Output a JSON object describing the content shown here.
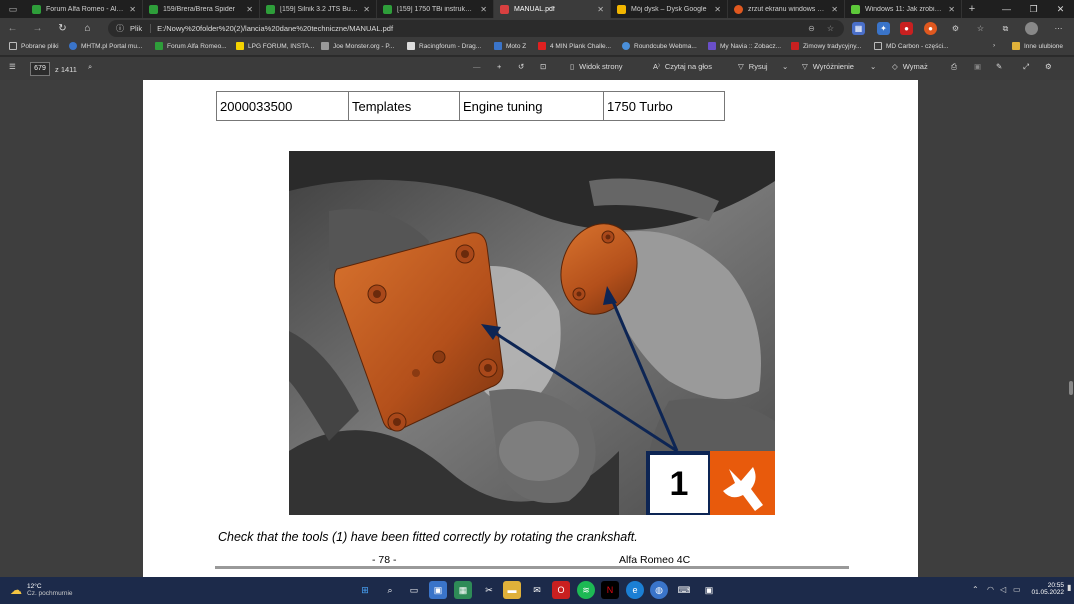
{
  "tabs": [
    {
      "title": "Forum Alfa Romeo - Alfaho",
      "color": "#2e9e3a"
    },
    {
      "title": "159/Brera/Brera Spider",
      "color": "#2e9e3a"
    },
    {
      "title": "[159] Silnik 3.2 JTS Budowa",
      "color": "#2e9e3a"
    },
    {
      "title": "[159] 1750 TBi instrukcja w",
      "color": "#2e9e3a"
    },
    {
      "title": "MANUAL.pdf",
      "color": "#d94040"
    },
    {
      "title": "Mój dysk – Dysk Google",
      "color": "#f2b600"
    },
    {
      "title": "zrzut ekranu windows 11 a",
      "color": "#e0581f"
    },
    {
      "title": "Windows 11: Jak zrobić zrz",
      "color": "#5ec93a"
    }
  ],
  "address": {
    "scheme": "Plik",
    "url": "E:/Nowy%20folder%20(2)/lancia%20dane%20techniczne/MANUAL.pdf"
  },
  "bookmarks": [
    {
      "label": "Pobrane pliki",
      "color": "#bbbbbb"
    },
    {
      "label": "MHTM.pl Portal mu...",
      "color": "#3a74c9"
    },
    {
      "label": "Forum Alfa Romeo...",
      "color": "#2e9e3a"
    },
    {
      "label": "LPG FORUM, INSTA...",
      "color": "#f5d300"
    },
    {
      "label": "Joe Monster.org - P...",
      "color": "#999999"
    },
    {
      "label": "Racingforum - Drag...",
      "color": "#dddddd"
    },
    {
      "label": "Moto Z",
      "color": "#3a74c9"
    },
    {
      "label": "4 MIN Plank Challe...",
      "color": "#e02020"
    },
    {
      "label": "Roundcube Webma...",
      "color": "#4a8fd9"
    },
    {
      "label": "My Navia :: Zobacz...",
      "color": "#6a4fc9"
    },
    {
      "label": "Zimowy tradycyjny...",
      "color": "#c92020"
    },
    {
      "label": "MD Carbon - części...",
      "color": "#bbbbbb"
    }
  ],
  "other_bookmarks": "Inne ulubione",
  "pdf_toolbar": {
    "page": "679",
    "of_pages": "z 1411",
    "page_view": "Widok strony",
    "read_aloud": "Czytaj na głos",
    "draw": "Rysuj",
    "highlight": "Wyróżnienie",
    "erase": "Wymaż"
  },
  "pdf_page": {
    "table": [
      "2000033500",
      "Templates",
      "Engine tuning",
      "1750 Turbo"
    ],
    "caption": "Check that the tools (1) have been fitted correctly by rotating the crankshaft.",
    "callout_number": "1",
    "page_number": "- 78 -",
    "footer_brand": "Alfa Romeo 4C"
  },
  "taskbar": {
    "weather_temp": "12°C",
    "weather_desc": "Cz. pochmurnie",
    "time": "20:55",
    "date": "01.05.2022"
  }
}
